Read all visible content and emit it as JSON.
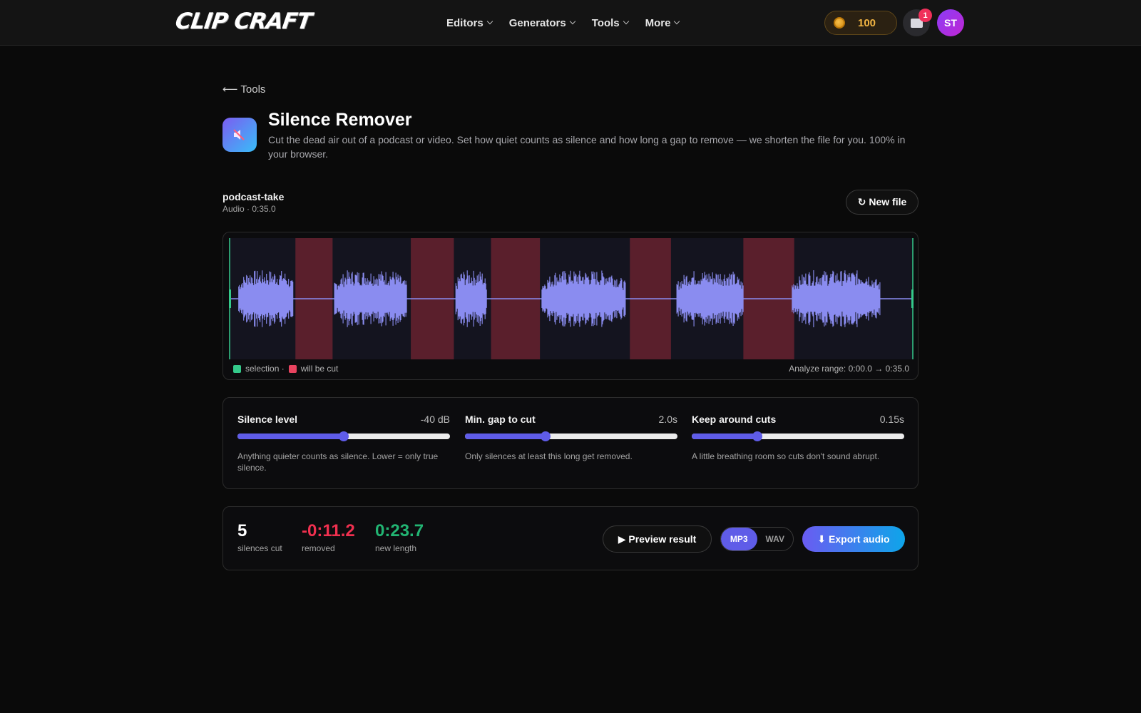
{
  "brand": {
    "logo": "CLIP CRAFT"
  },
  "nav": [
    {
      "label": "Editors"
    },
    {
      "label": "Generators"
    },
    {
      "label": "Tools"
    },
    {
      "label": "More"
    }
  ],
  "header": {
    "coins": "100",
    "notifications": "1",
    "avatar": "ST"
  },
  "page": {
    "back": "⟵ Tools",
    "title": "Silence Remover",
    "description": "Cut the dead air out of a podcast or video. Set how quiet counts as silence and how long a gap to remove — we shorten the file for you. 100% in your browser."
  },
  "file": {
    "name": "podcast-take",
    "meta": "Audio · 0:35.0",
    "new_file_label": "↻ New file"
  },
  "waveform": {
    "legend_selection": "selection ·",
    "legend_cut": "will be cut",
    "range_text": "Analyze range: 0:00.0 → 0:35.0",
    "duration_s": 35.0,
    "selection": [
      0.0,
      35.0
    ],
    "speech_segments": [
      [
        0.5,
        3.3
      ],
      [
        5.4,
        9.1
      ],
      [
        11.6,
        13.2
      ],
      [
        16.0,
        20.3
      ],
      [
        22.9,
        26.3
      ],
      [
        28.8,
        33.3
      ]
    ],
    "cut_segments": [
      [
        3.4,
        5.3
      ],
      [
        9.3,
        11.5
      ],
      [
        13.4,
        15.9
      ],
      [
        20.5,
        22.6
      ],
      [
        26.3,
        28.9
      ]
    ],
    "colors": {
      "wave": "#8a8cf0",
      "cut": "#5a1f2c",
      "selection": "#34c98a",
      "bg": "#14141f"
    }
  },
  "controls": [
    {
      "label": "Silence level",
      "value": "-40 dB",
      "fraction": 0.5,
      "help": "Anything quieter counts as silence. Lower = only true silence."
    },
    {
      "label": "Min. gap to cut",
      "value": "2.0s",
      "fraction": 0.38,
      "help": "Only silences at least this long get removed."
    },
    {
      "label": "Keep around cuts",
      "value": "0.15s",
      "fraction": 0.31,
      "help": "A little breathing room so cuts don't sound abrupt."
    }
  ],
  "result": {
    "silences_cut": "5",
    "silences_cut_label": "silences cut",
    "removed": "-0:11.2",
    "removed_label": "removed",
    "new_length": "0:23.7",
    "new_length_label": "new length",
    "preview_label": "▶ Preview result",
    "formats": [
      "MP3",
      "WAV"
    ],
    "export_label": "⬇ Export audio",
    "colors": {
      "removed": "#f0304f",
      "new_length": "#22b573"
    }
  }
}
